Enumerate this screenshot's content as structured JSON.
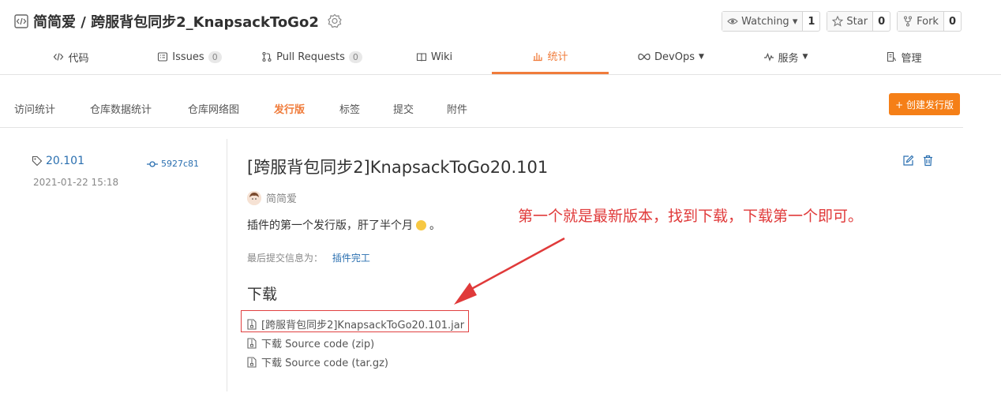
{
  "repo": {
    "title": "简简爱 / 跨服背包同步2_KnapsackToGo2",
    "watch_label": "Watching ▾",
    "watch_count": "1",
    "star_label": "Star",
    "star_count": "0",
    "fork_label": "Fork",
    "fork_count": "0"
  },
  "nav": {
    "code": "代码",
    "issues": "Issues",
    "issues_count": "0",
    "pull_requests": "Pull Requests",
    "pull_requests_count": "0",
    "wiki": "Wiki",
    "stats": "统计",
    "devops": "DevOps",
    "services": "服务",
    "manage": "管理"
  },
  "subnav": {
    "items": [
      "访问统计",
      "仓库数据统计",
      "仓库网络图",
      "发行版",
      "标签",
      "提交",
      "附件"
    ],
    "active_index": 3,
    "create_label": "+ 创建发行版"
  },
  "release": {
    "tag": "20.101",
    "commit": "5927c81",
    "date": "2021-01-22 15:18",
    "title": "[跨服背包同步2]KnapsackToGo20.101",
    "author": "简简爱",
    "description": "插件的第一个发行版，肝了半个月",
    "description_end": "。",
    "commit_label": "最后提交信息为：",
    "commit_message": "插件完工",
    "download_heading": "下载",
    "assets": [
      "[跨服背包同步2]KnapsackToGo20.101.jar",
      "下载 Source code (zip)",
      "下载 Source code (tar.gz)"
    ]
  },
  "annotation": "第一个就是最新版本，找到下载，下载第一个即可。",
  "colors": {
    "accent": "#f07c3b",
    "link": "#2a6fb0",
    "annotation": "#e03a3a"
  }
}
